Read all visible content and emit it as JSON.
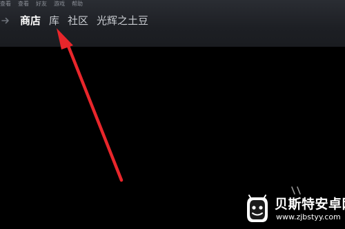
{
  "menubar": {
    "items": [
      "查看",
      "查看",
      "好友",
      "游戏",
      "帮助"
    ]
  },
  "nav": {
    "arrow_icon": "arrow-right-icon",
    "items": [
      {
        "label": "商店",
        "active": true
      },
      {
        "label": "库",
        "active": false
      },
      {
        "label": "社区",
        "active": false
      },
      {
        "label": "光辉之土豆",
        "active": false
      }
    ]
  },
  "annotation": {
    "color": "#e8262b"
  },
  "watermark": {
    "title": "贝斯特安卓网",
    "url": "www.zjbstyy.com"
  }
}
